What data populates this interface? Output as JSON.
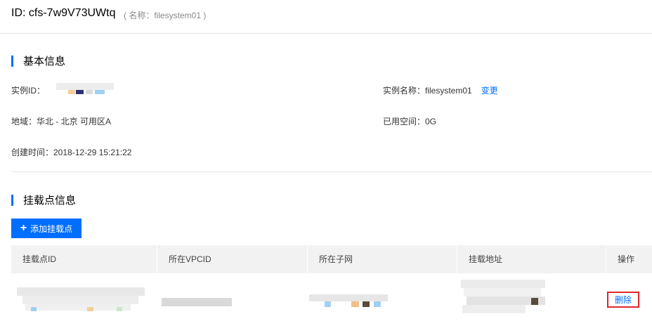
{
  "header": {
    "title": "ID: cfs-7w9V73UWtq",
    "subtitle": "( 名称：filesystem01   )"
  },
  "basic_info": {
    "section_title": "基本信息",
    "instance_id_label": "实例ID：",
    "instance_name": "实例名称：filesystem01",
    "rename_link": "变更",
    "region": "地域：华北 - 北京 可用区A",
    "used_space": "已用空间：0G",
    "created_time": "创建时间：2018-12-29 15:21:22"
  },
  "mount_points": {
    "section_title": "挂载点信息",
    "add_button": "添加挂载点",
    "columns": [
      "挂载点ID",
      "所在VPCID",
      "所在子网",
      "挂载地址",
      "操作"
    ],
    "rows": [
      {
        "action": "删除"
      }
    ]
  },
  "colors": {
    "accent": "#006eff",
    "highlight_border": "#e0262a",
    "table_header_bg": "#f2f2f2"
  }
}
